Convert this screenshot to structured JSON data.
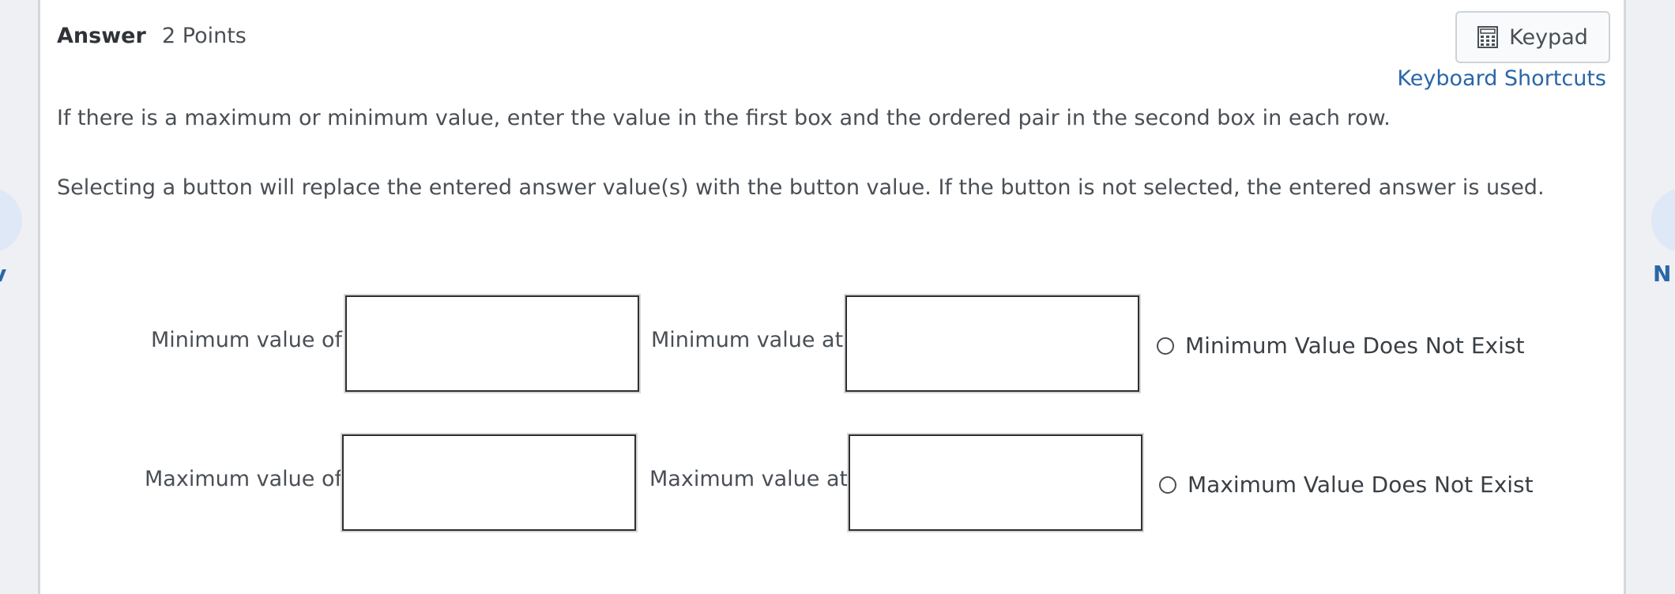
{
  "nav": {
    "prev_label": "v",
    "next_label": "N"
  },
  "header": {
    "title": "Answer",
    "points": "2 Points",
    "keypad_label": "Keypad",
    "shortcuts_label": "Keyboard Shortcuts"
  },
  "instructions": {
    "line1": "If there is a maximum or minimum value, enter the value in the first box and the ordered pair in the second box in each row.",
    "line2": "Selecting a button will replace the entered answer value(s) with the button value. If the button is not selected, the entered answer is used."
  },
  "rows": {
    "min": {
      "value_label": "Minimum value of",
      "at_label": "Minimum value at",
      "value_input": "",
      "at_input": "",
      "dne_label": "Minimum Value Does Not Exist"
    },
    "max": {
      "value_label": "Maximum value of",
      "at_label": "Maximum value at",
      "value_input": "",
      "at_input": "",
      "dne_label": "Maximum Value Does Not Exist"
    }
  },
  "colors": {
    "link": "#2a66a8",
    "text": "#4a4f55",
    "nav_circle": "#dfe8f6"
  }
}
